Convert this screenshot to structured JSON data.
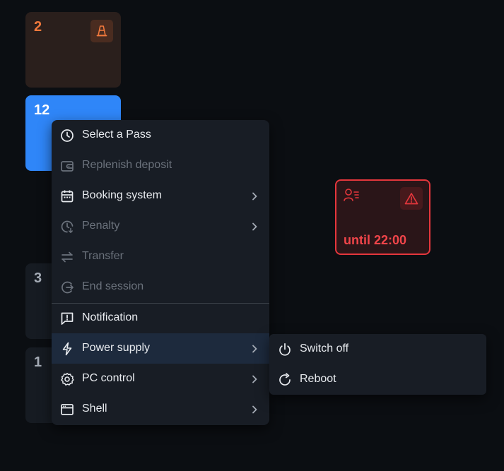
{
  "tiles": {
    "t2": {
      "number": "2"
    },
    "t12": {
      "number": "12"
    },
    "t3": {
      "number": "3"
    },
    "t1": {
      "number": "1"
    },
    "alert": {
      "until": "until 22:00"
    }
  },
  "menu": {
    "items": [
      {
        "label": "Select a Pass",
        "icon": "clock-icon",
        "disabled": false,
        "submenu": false
      },
      {
        "label": "Replenish deposit",
        "icon": "wallet-icon",
        "disabled": true,
        "submenu": false
      },
      {
        "label": "Booking system",
        "icon": "calendar-icon",
        "disabled": false,
        "submenu": true
      },
      {
        "label": "Penalty",
        "icon": "clock-down-icon",
        "disabled": true,
        "submenu": true
      },
      {
        "label": "Transfer",
        "icon": "transfer-arrows-icon",
        "disabled": true,
        "submenu": false
      },
      {
        "label": "End session",
        "icon": "logout-circle-icon",
        "disabled": true,
        "submenu": false
      },
      {
        "label": "Notification",
        "icon": "message-alert-icon",
        "disabled": false,
        "submenu": false
      },
      {
        "label": "Power supply",
        "icon": "lightning-icon",
        "disabled": false,
        "submenu": true,
        "active": true
      },
      {
        "label": "PC control",
        "icon": "gear-icon",
        "disabled": false,
        "submenu": true
      },
      {
        "label": "Shell",
        "icon": "window-icon",
        "disabled": false,
        "submenu": true
      }
    ]
  },
  "submenu": {
    "items": [
      {
        "label": "Switch off",
        "icon": "power-icon"
      },
      {
        "label": "Reboot",
        "icon": "reboot-icon"
      }
    ]
  },
  "colors": {
    "background": "#0b0e12",
    "accent_blue": "#2f86f8",
    "alert_red": "#e5363c",
    "orange": "#f0783c",
    "menu_bg": "#181d25",
    "menu_active": "#1d2a3d"
  }
}
